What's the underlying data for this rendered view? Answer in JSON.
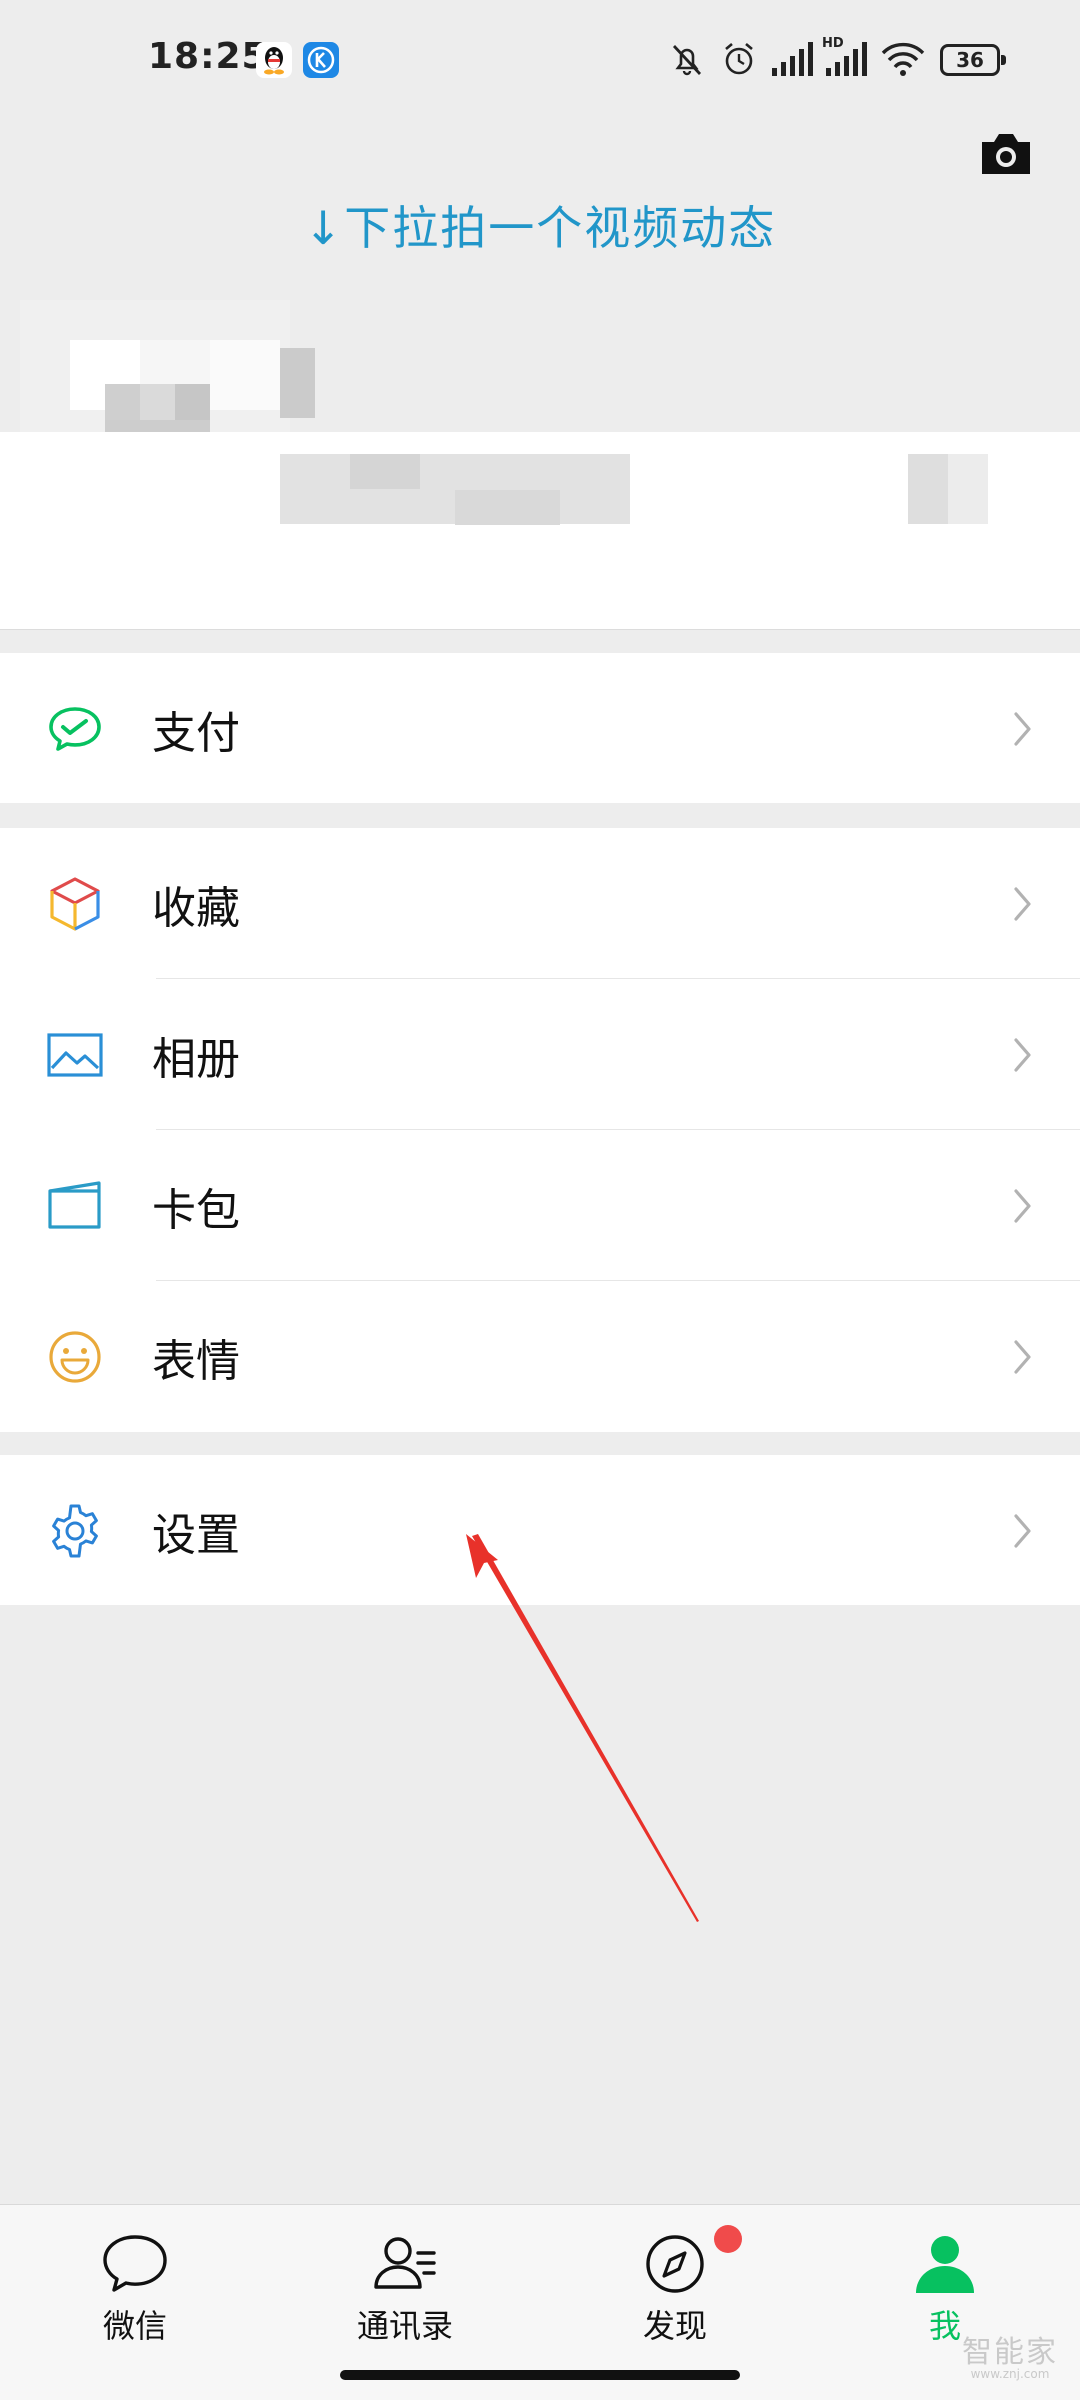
{
  "status_bar": {
    "time": "18:25",
    "battery": "36",
    "signal_label": "HD"
  },
  "top": {
    "pull_hint": "↓下拉拍一个视频动态"
  },
  "menu": {
    "pay": {
      "label": "支付",
      "icon": "wechat-pay-icon"
    },
    "favorites": {
      "label": "收藏",
      "icon": "cube-icon"
    },
    "album": {
      "label": "相册",
      "icon": "picture-icon"
    },
    "cards": {
      "label": "卡包",
      "icon": "card-icon"
    },
    "stickers": {
      "label": "表情",
      "icon": "smiley-icon"
    },
    "settings": {
      "label": "设置",
      "icon": "gear-icon"
    }
  },
  "tab_bar": {
    "tabs": [
      {
        "label": "微信",
        "icon": "chat-bubble-icon"
      },
      {
        "label": "通讯录",
        "icon": "contacts-icon"
      },
      {
        "label": "发现",
        "icon": "compass-icon"
      },
      {
        "label": "我",
        "icon": "person-icon"
      }
    ],
    "active_index": 3
  },
  "watermark": {
    "text": "智能家",
    "url": "www.znj.com"
  },
  "colors": {
    "accent_green": "#07c160",
    "hint_blue": "#2196c9",
    "badge_red": "#f04b4b",
    "annotation_red": "#e8312a"
  }
}
